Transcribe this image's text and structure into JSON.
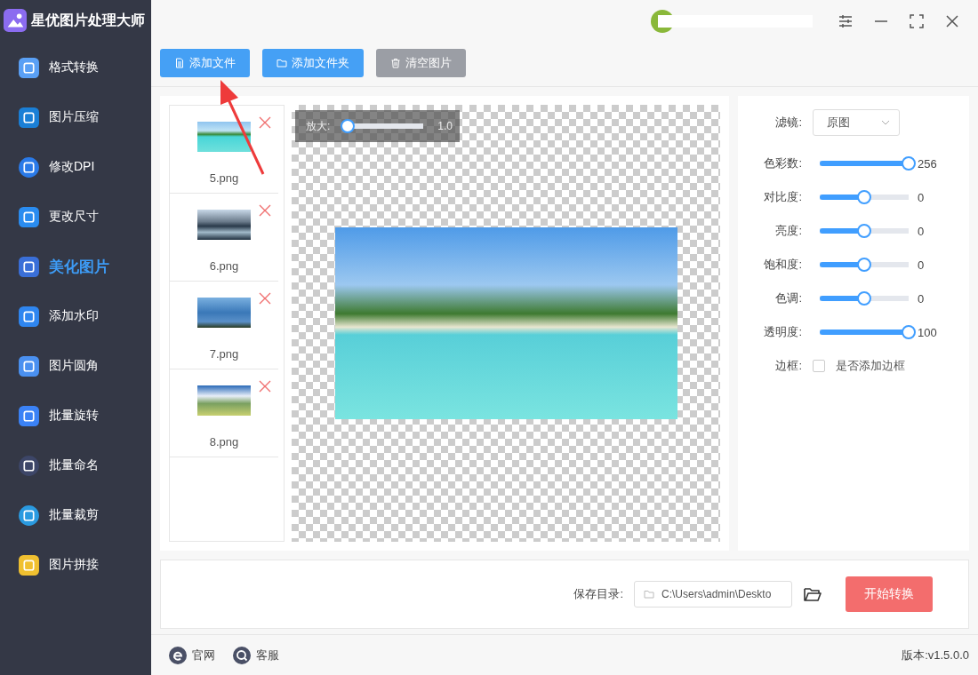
{
  "app": {
    "title": "星优图片处理大师"
  },
  "sidebar": {
    "items": [
      {
        "label": "格式转换",
        "selected": false
      },
      {
        "label": "图片压缩",
        "selected": false
      },
      {
        "label": "修改DPI",
        "selected": false
      },
      {
        "label": "更改尺寸",
        "selected": false
      },
      {
        "label": "美化图片",
        "selected": true
      },
      {
        "label": "添加水印",
        "selected": false
      },
      {
        "label": "图片圆角",
        "selected": false
      },
      {
        "label": "批量旋转",
        "selected": false
      },
      {
        "label": "批量命名",
        "selected": false
      },
      {
        "label": "批量裁剪",
        "selected": false
      },
      {
        "label": "图片拼接",
        "selected": false
      }
    ]
  },
  "toolbar": {
    "buttons": [
      {
        "label": "添加文件",
        "kind": "file"
      },
      {
        "label": "添加文件夹",
        "kind": "folder"
      },
      {
        "label": "清空图片",
        "kind": "clear"
      }
    ]
  },
  "files": [
    {
      "name": "5.png"
    },
    {
      "name": "6.png"
    },
    {
      "name": "7.png"
    },
    {
      "name": "8.png"
    }
  ],
  "zoom": {
    "label": "放大:",
    "level": 0.04,
    "reading": "1.0"
  },
  "settings": {
    "filter": {
      "label": "滤镜:",
      "value": "原图"
    },
    "sliders": [
      {
        "label": "色彩数:",
        "level": 1,
        "reading": "256"
      },
      {
        "label": "对比度:",
        "level": 0.5,
        "reading": "0"
      },
      {
        "label": "亮度:",
        "level": 0.5,
        "reading": "0"
      },
      {
        "label": "饱和度:",
        "level": 0.5,
        "reading": "0"
      },
      {
        "label": "色调:",
        "level": 0.5,
        "reading": "0"
      },
      {
        "label": "透明度:",
        "level": 1,
        "reading": "100"
      }
    ],
    "border": {
      "label": "边框:",
      "checked": false,
      "option": "是否添加边框"
    }
  },
  "save": {
    "label": "保存目录:",
    "path": "C:\\Users\\admin\\Deskto",
    "start": "开始转换"
  },
  "footer": {
    "links": [
      {
        "label": "官网",
        "kind": "web"
      },
      {
        "label": "客服",
        "kind": "service"
      }
    ],
    "version": "版本:v1.5.0.0"
  }
}
